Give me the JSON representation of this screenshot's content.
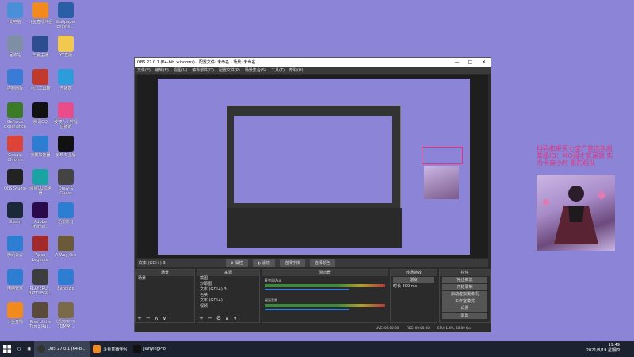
{
  "desktop_icons": [
    {
      "label": "此电脑",
      "icon": "computer-icon",
      "color": "#4a90d9"
    },
    {
      "label": "斗鱼直播伴侣",
      "icon": "douyu-icon",
      "color": "#f28a1e"
    },
    {
      "label": "Wallpaper\nEngine:...",
      "icon": "wallpaper-icon",
      "color": "#2a5fa8"
    },
    {
      "label": "回收站",
      "icon": "recycle-bin-icon",
      "color": "#7f8fa6"
    },
    {
      "label": "华夏主播",
      "icon": "app-icon",
      "color": "#2d4d91"
    },
    {
      "label": "YY直播",
      "icon": "yy-icon",
      "color": "#f2c94c"
    },
    {
      "label": "控制面板",
      "icon": "control-panel-icon",
      "color": "#3a7bd5"
    },
    {
      "label": "小丸工具箱",
      "icon": "toolbox-icon",
      "color": "#c0392b"
    },
    {
      "label": "开播端",
      "icon": "live-icon",
      "color": "#2d9cdb"
    },
    {
      "label": "GeForce\nExperience",
      "icon": "geforce-icon",
      "color": "#3b7a27"
    },
    {
      "label": "腾讯QQ",
      "icon": "qq-icon",
      "color": "#111111"
    },
    {
      "label": "棱镜人 / 哔哩\n直播姬",
      "icon": "bilibili-icon",
      "color": "#e84d8a"
    },
    {
      "label": "Google\nChrome",
      "icon": "chrome-icon",
      "color": "#db4437"
    },
    {
      "label": "天翼加速器",
      "icon": "accelerator-icon",
      "color": "#2d7dd2"
    },
    {
      "label": "剪映专业版",
      "icon": "capcut-icon",
      "color": "#111111"
    },
    {
      "label": "OBS Studio",
      "icon": "obs-icon",
      "color": "#222222"
    },
    {
      "label": "网易UU加速\n器",
      "icon": "uu-icon",
      "color": "#19a3a3"
    },
    {
      "label": "Draw &\nGuess",
      "icon": "draw-icon",
      "color": "#444444"
    },
    {
      "label": "Steam",
      "icon": "steam-icon",
      "color": "#1b2838"
    },
    {
      "label": "Adobe\nPremie...",
      "icon": "premiere-icon",
      "color": "#2a0a4a"
    },
    {
      "label": "迅雷影音",
      "icon": "player-icon",
      "color": "#2d7dd2"
    },
    {
      "label": "腾讯会议",
      "icon": "meeting-icon",
      "color": "#2d7dd2"
    },
    {
      "label": "Apex\nLegends",
      "icon": "apex-icon",
      "color": "#a32a2a"
    },
    {
      "label": "A Way Out",
      "icon": "game-icon",
      "color": "#6b5a3a"
    },
    {
      "label": "电脑管家",
      "icon": "shield-icon",
      "color": "#2d7dd2"
    },
    {
      "label": "PLAYERU...\nBATTLEGR...",
      "icon": "pubg-icon",
      "color": "#3d3d3d"
    },
    {
      "label": "Bandizip",
      "icon": "bandizip-icon",
      "color": "#2d7dd2"
    },
    {
      "label": "斗鱼直播",
      "icon": "douyu-icon",
      "color": "#f28a1e"
    },
    {
      "label": "Rise of the\nTomb Rai...",
      "icon": "tombraider-icon",
      "color": "#5a4a3a"
    },
    {
      "label": "《恐怖实习》\n3DM整...",
      "icon": "game-icon",
      "color": "#7a6a4a"
    }
  ],
  "obs": {
    "title": "OBS 27.0.1 (64-bit, windows) - 配置文件: 未命名 - 场景: 未命名",
    "controls": [
      "—",
      "□",
      "✕"
    ],
    "menu": [
      "文件(F)",
      "编辑(E)",
      "视图(V)",
      "停靠部件(D)",
      "配置文件(P)",
      "场景集合(S)",
      "工具(T)",
      "帮助(H)"
    ],
    "source_bar": {
      "label": "文本 (GDI+) 3",
      "props": "属性",
      "filters": "滤镜",
      "select_font": "选择字体",
      "select_color": "选择颜色"
    },
    "docks": {
      "scenes": {
        "title": "场景",
        "items": [
          "场景"
        ]
      },
      "sources": {
        "title": "来源",
        "items": [
          "截图",
          "沙耶图",
          "文本 (GDI+) 3",
          "色块",
          "文本 (GDI+)",
          "视频"
        ]
      },
      "mixer": {
        "title": "混音器",
        "channels": [
          {
            "name": "麦克风/Aux"
          },
          {
            "name": "桌面音频"
          }
        ]
      },
      "transitions": {
        "title": "转场特效",
        "type": "渐变",
        "duration_label": "时长",
        "duration": "300 ms"
      },
      "controls": {
        "title": "控件",
        "buttons": [
          "停止推流",
          "开始录制",
          "启动虚拟摄像机",
          "工作室模式",
          "设置",
          "退出"
        ]
      }
    },
    "status": {
      "live": "LIVE: 00:00:00",
      "rec": "REC: 00:00:00",
      "cpu": "CPU: 1.4%, 60.00 fps"
    }
  },
  "overlay": {
    "text": "抖码和采买七宝广普连热组 某级ID：MO弱才实深刻 实力卡商小时 影的组队"
  },
  "taskbar": {
    "items": [
      {
        "label": "OBS 27.0.1 (64-bi...",
        "color": "#333333"
      },
      {
        "label": "斗鱼直播伴侣",
        "color": "#f28a1e"
      },
      {
        "label": "JianyingPro",
        "color": "#111111"
      }
    ],
    "time": "19:49",
    "date": "2021/8/19 星期四"
  }
}
